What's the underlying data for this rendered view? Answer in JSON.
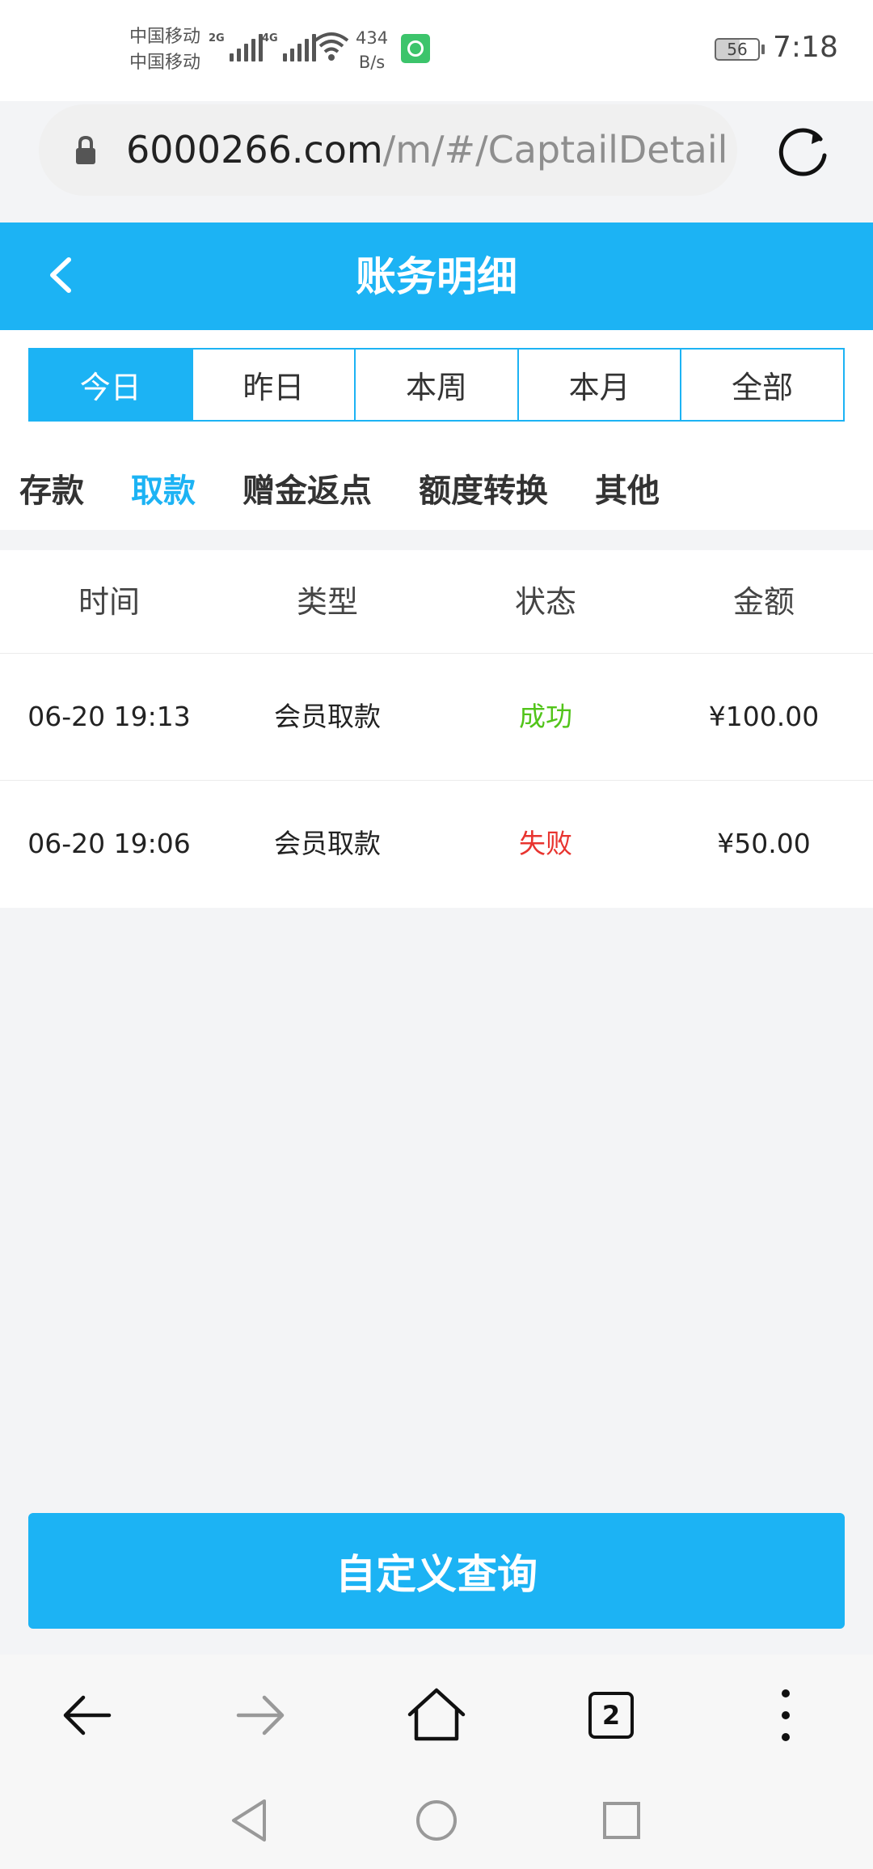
{
  "status_bar": {
    "carrier_1": "中国移动",
    "carrier_2": "中国移动",
    "sim1_network": "2G",
    "sim2_network": "4G",
    "net_speed_value": "434",
    "net_speed_unit": "B/s",
    "battery_level": "56",
    "time": "7:18"
  },
  "browser": {
    "url_host": "6000266.com",
    "url_path": "/m/#/CaptailDetail",
    "open_tabs": "2"
  },
  "header": {
    "title": "账务明细"
  },
  "date_tabs": [
    {
      "label": "今日",
      "active": true
    },
    {
      "label": "昨日",
      "active": false
    },
    {
      "label": "本周",
      "active": false
    },
    {
      "label": "本月",
      "active": false
    },
    {
      "label": "全部",
      "active": false
    }
  ],
  "category_tabs": [
    {
      "label": "存款",
      "active": false
    },
    {
      "label": "取款",
      "active": true
    },
    {
      "label": "赠金返点",
      "active": false
    },
    {
      "label": "额度转换",
      "active": false
    },
    {
      "label": "其他",
      "active": false
    }
  ],
  "table": {
    "columns": [
      "时间",
      "类型",
      "状态",
      "金额"
    ],
    "rows": [
      {
        "time": "06-20 19:13",
        "type": "会员取款",
        "status": "成功",
        "amount": "¥100.00"
      },
      {
        "time": "06-20 19:06",
        "type": "会员取款",
        "status": "失败",
        "amount": "¥50.00"
      }
    ]
  },
  "query_button": {
    "label": "自定义查询"
  },
  "colors": {
    "primary": "#1cb3f4",
    "status_success": "#52c41a",
    "status_failed": "#e8342f",
    "background": "#f3f4f6"
  },
  "icons": {
    "lock": "lock-icon",
    "reload": "reload-icon",
    "back": "chevron-left-icon",
    "browser_back": "arrow-left-icon",
    "browser_forward": "arrow-right-icon",
    "home": "home-icon",
    "tabs": "tabs-icon",
    "menu": "more-vertical-icon",
    "nav_back": "triangle-back-icon",
    "nav_home": "circle-home-icon",
    "nav_recents": "square-recents-icon"
  }
}
